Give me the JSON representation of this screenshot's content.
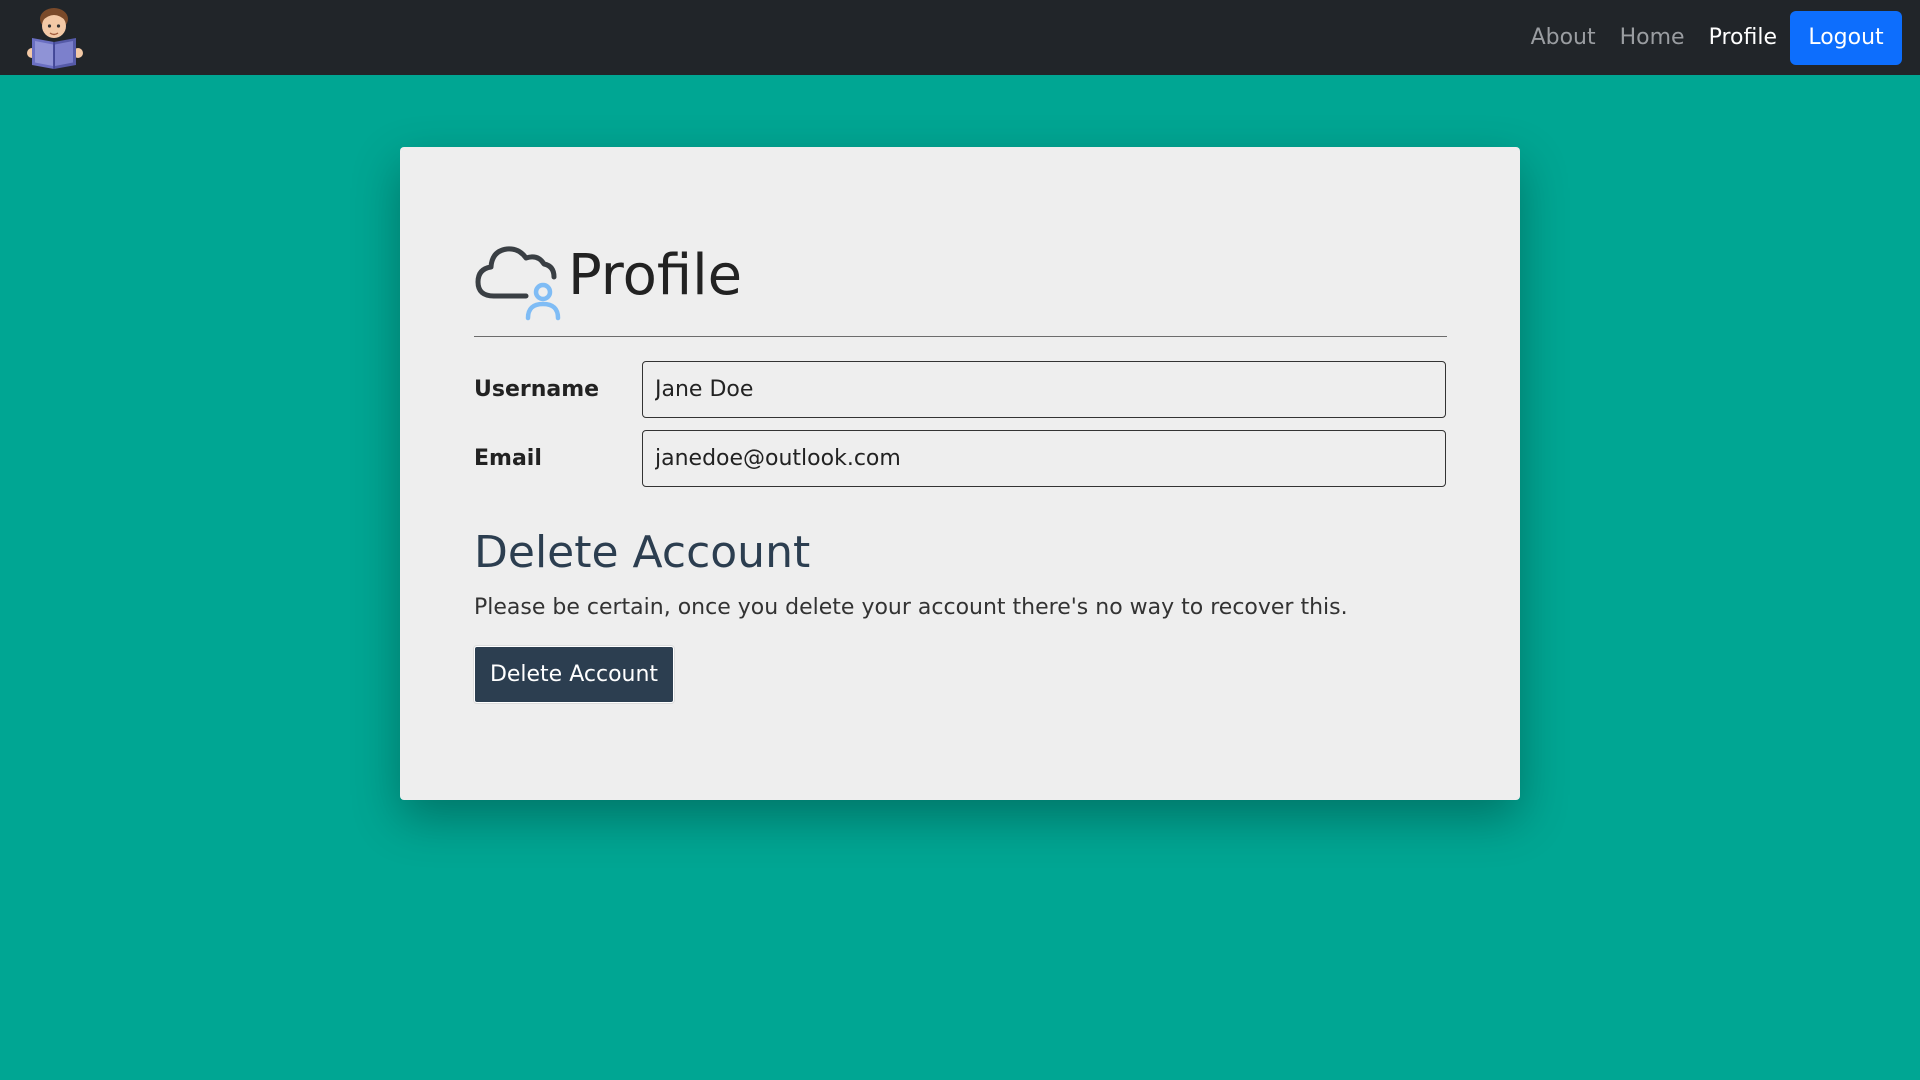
{
  "navbar": {
    "logo_icon": "reading-person-logo",
    "links": [
      {
        "label": "About",
        "active": false
      },
      {
        "label": "Home",
        "active": false
      },
      {
        "label": "Profile",
        "active": true
      }
    ],
    "logout_label": "Logout"
  },
  "card": {
    "title_icon": "cloud-user-icon",
    "title": "Profile",
    "fields": [
      {
        "label": "Username",
        "value": "Jane Doe"
      },
      {
        "label": "Email",
        "value": "janedoe@outlook.com"
      }
    ],
    "delete_section": {
      "title": "Delete Account",
      "warning": "Please be certain, once you delete your account there's no way to recover this.",
      "button_label": "Delete Account"
    }
  },
  "colors": {
    "page_background": "#00a693",
    "navbar_background": "#212529",
    "logout_button": "#0d6efd",
    "card_background": "#eeeeee",
    "delete_button": "#2c3e50",
    "section_title": "#2c3e50"
  }
}
